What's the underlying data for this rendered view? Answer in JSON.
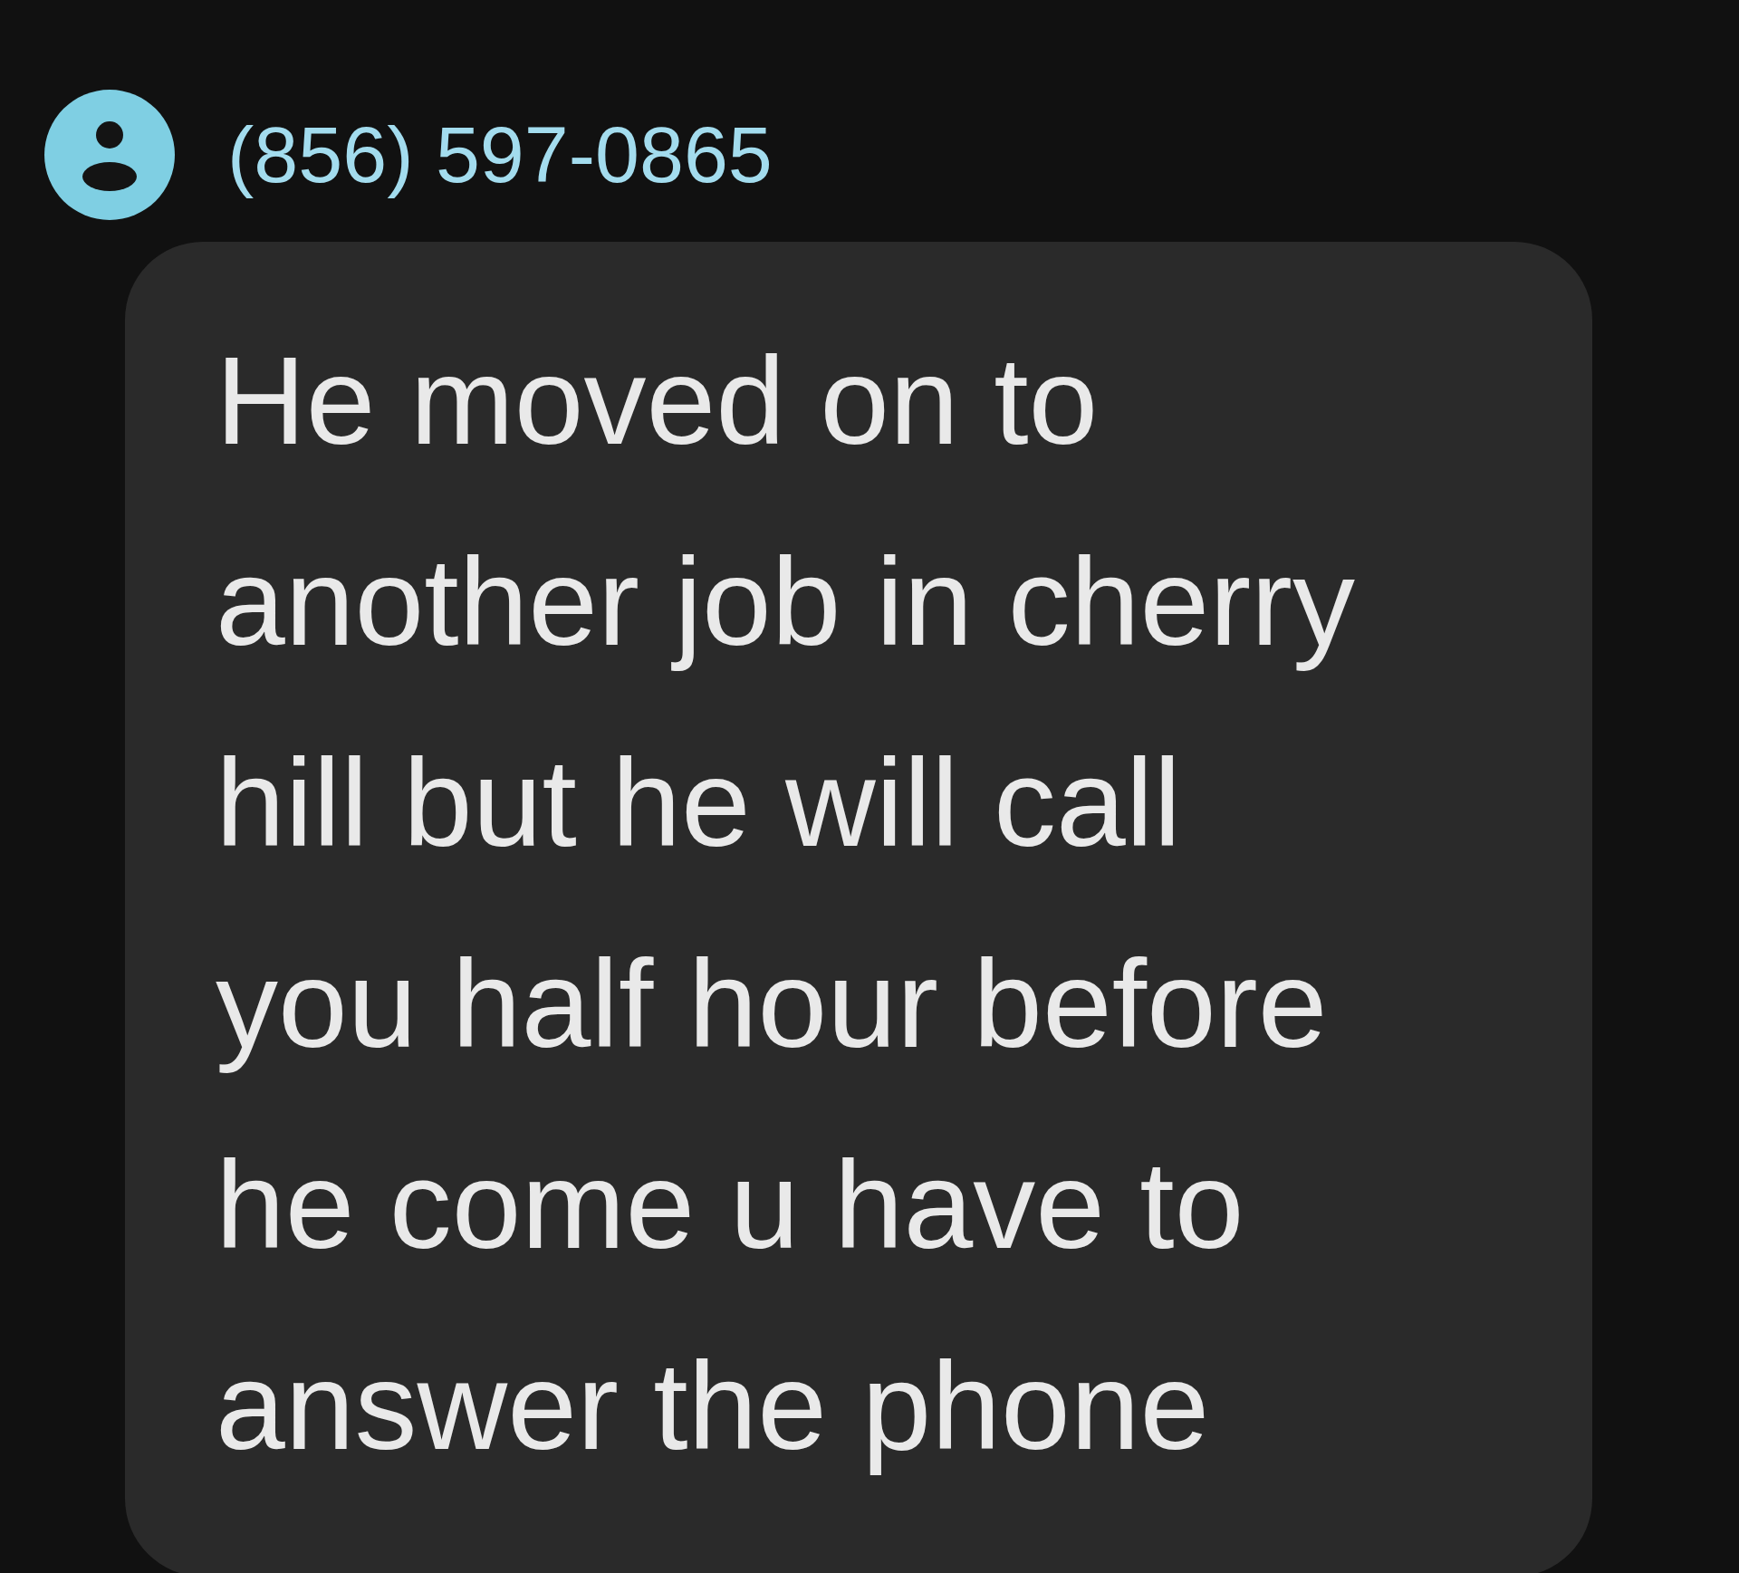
{
  "sender": {
    "name": "(856) 597-0865"
  },
  "message": {
    "lines": [
      "He moved on to",
      "another job in cherry",
      "hill but he will call",
      "you half hour before",
      "he come u have to",
      "answer the phone"
    ]
  }
}
